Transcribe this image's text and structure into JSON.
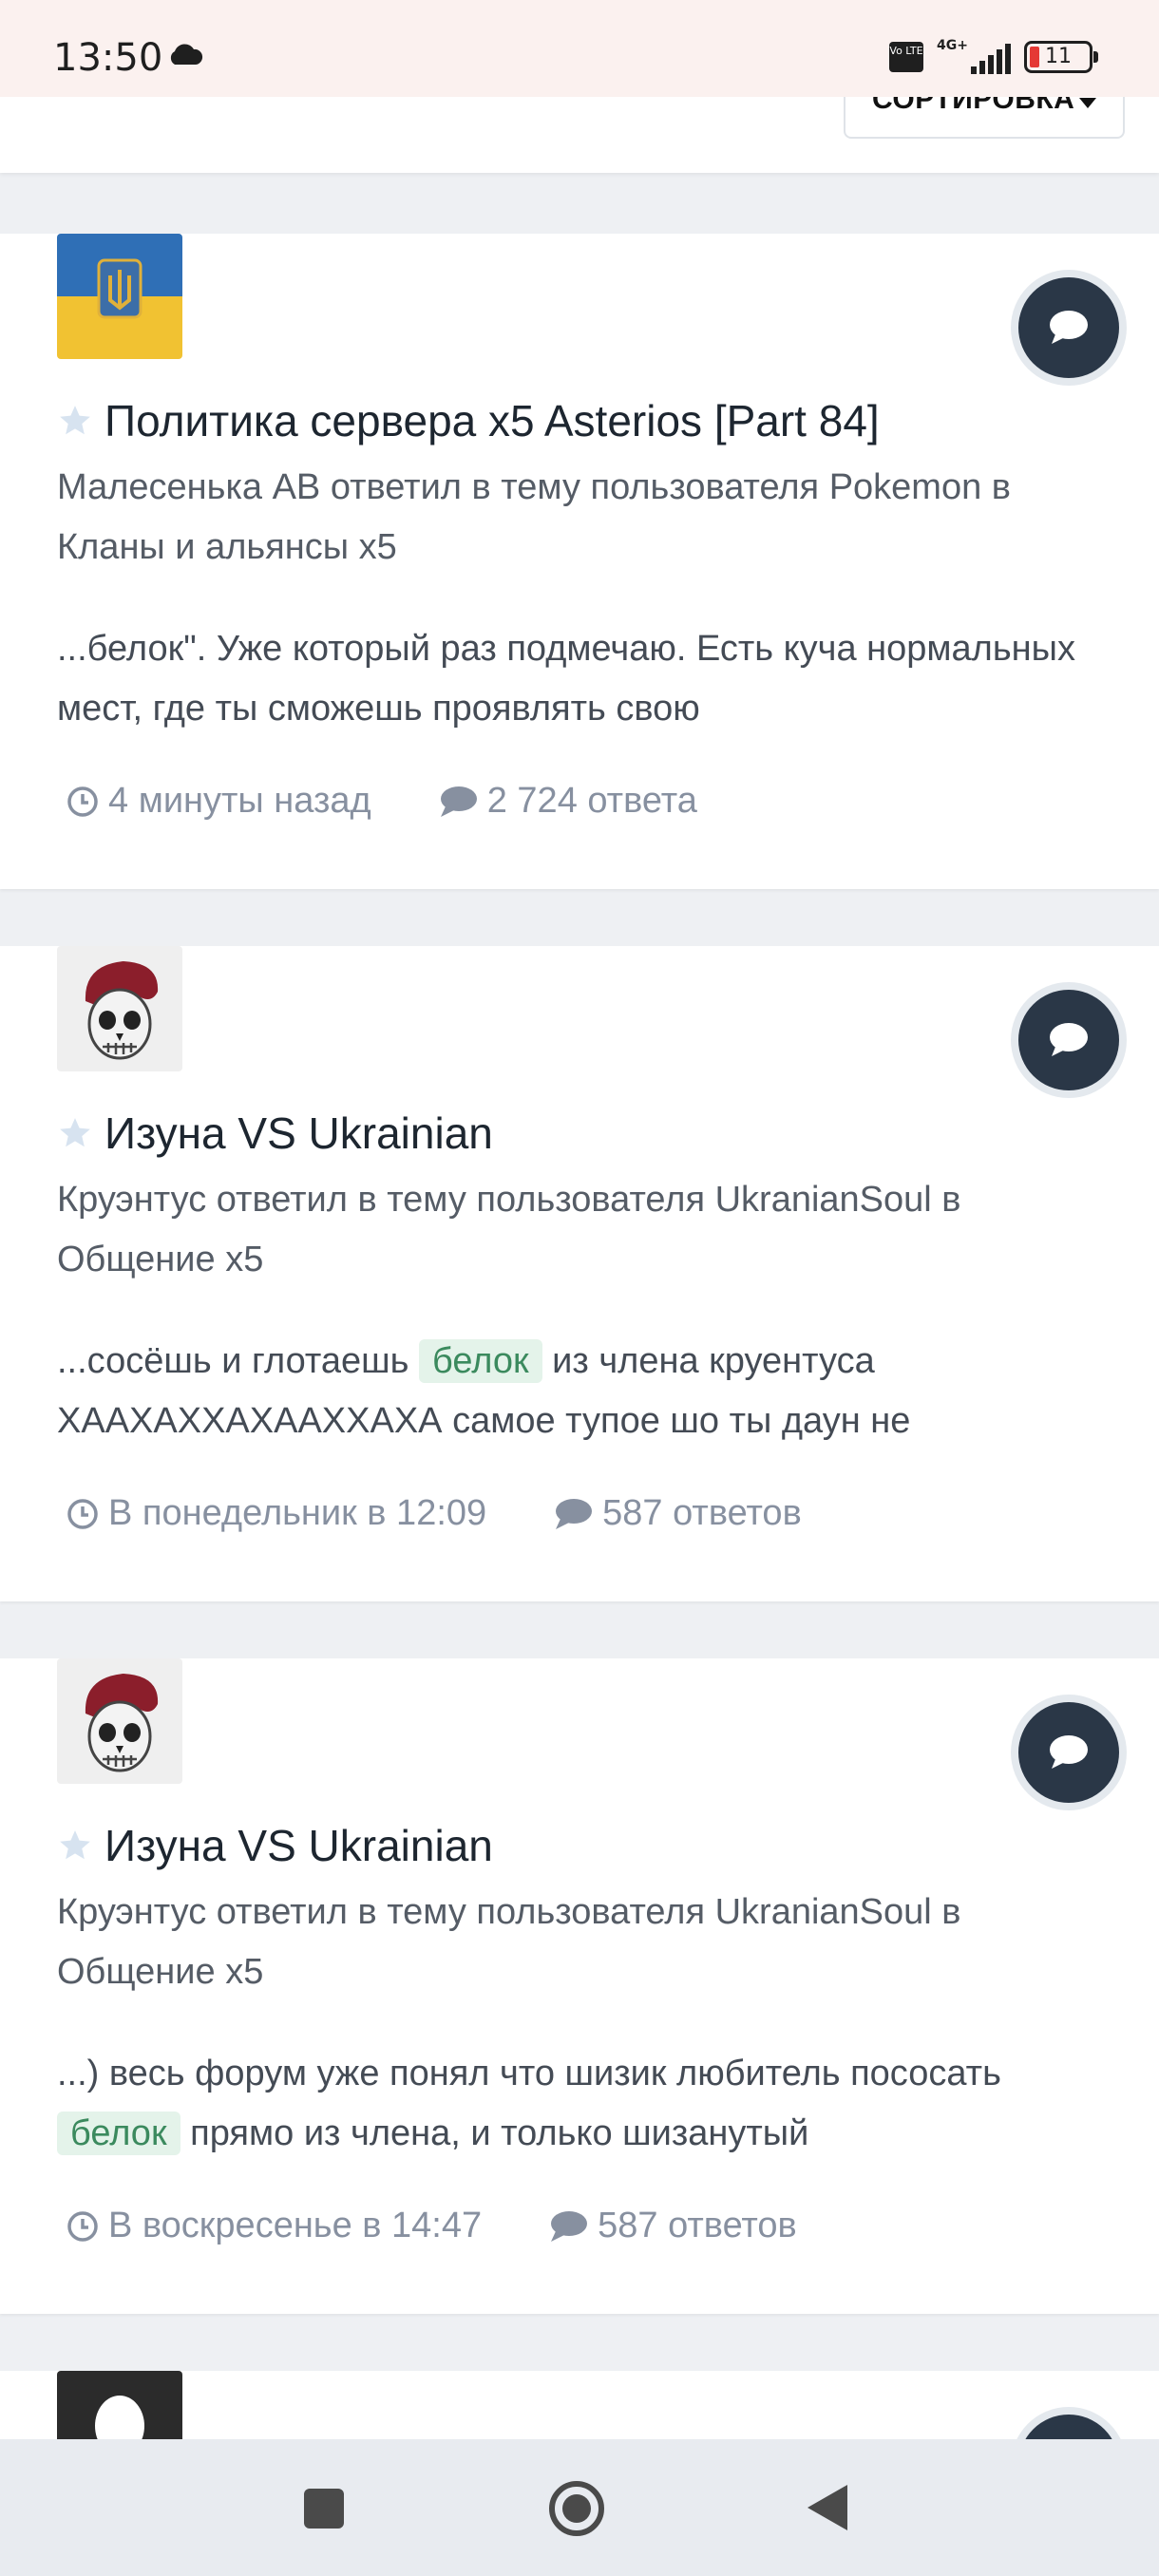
{
  "status_bar": {
    "time": "13:50",
    "network": "4G+",
    "volte": "Vo LTE",
    "battery": "11",
    "icons": [
      "cloud-icon",
      "volte-icon",
      "signal-icon",
      "battery-icon"
    ]
  },
  "toolbar": {
    "sort_label": "СОРТИРОВКА"
  },
  "posts": [
    {
      "title": "Политика сервера x5 Asterios [Part 84]",
      "meta": "Малесенька АВ ответил в тему пользователя Pokemon в Кланы и альянсы x5",
      "snippet_before": "...белок\". Уже который раз подмечаю. Есть куча нормальных мест, где ты сможешь проявлять свою",
      "snippet_highlight": "",
      "snippet_after": "",
      "time": "4 минуты назад",
      "replies": "2 724 ответа",
      "avatar": "ukraine-flag-avatar"
    },
    {
      "title": "Изуна VS Ukrainian",
      "meta": "Круэнтус ответил в тему пользователя UkranianSoul в Общение x5",
      "snippet_before": "...сосёшь и глотаешь ",
      "snippet_highlight": "белок",
      "snippet_after": " из члена круентуса ХААХАХХАХААХХАХА самое тупое шо ты даун не",
      "time": "В понедельник в 12:09",
      "replies": "587 ответов",
      "avatar": "skull-beret-avatar"
    },
    {
      "title": "Изуна VS Ukrainian",
      "meta": "Круэнтус ответил в тему пользователя UkranianSoul в Общение x5",
      "snippet_before": "...) весь форум уже понял что шизик любитель пососать ",
      "snippet_highlight": "белок",
      "snippet_after": " прямо из члена, и только шизанутый",
      "time": "В воскресенье в 14:47",
      "replies": "587 ответов",
      "avatar": "skull-beret-avatar"
    }
  ],
  "colors": {
    "accent_dark": "#2a3747",
    "highlight_bg": "#e4f3ea",
    "highlight_text": "#3b8a5e",
    "meta_gray": "#8790a0",
    "page_bg": "#eef0f3"
  },
  "nav_bar": {
    "icons": [
      "recents-square-icon",
      "home-circle-icon",
      "back-triangle-icon"
    ]
  }
}
